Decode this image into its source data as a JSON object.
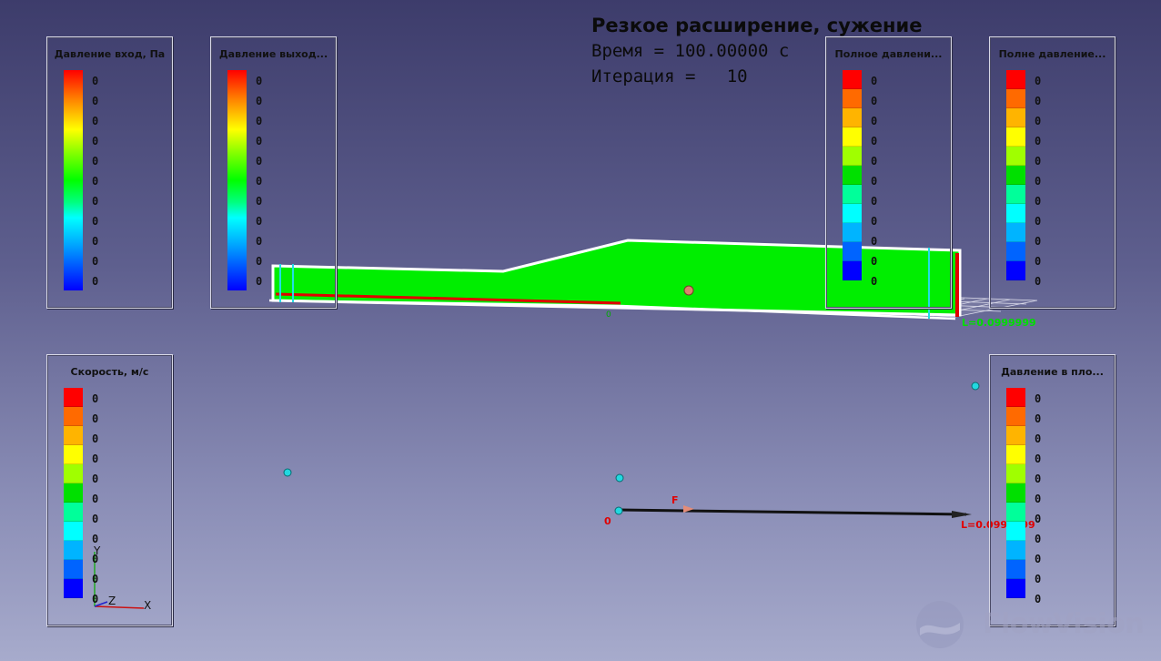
{
  "hud": {
    "title": "Резкое расширение, сужение",
    "time_line": "Время = 100.00000 с",
    "iteration_line": "Итерация =   10"
  },
  "legends": {
    "inlet_pressure": {
      "title": "Давление вход, Па",
      "style": "gradient",
      "values": [
        "0",
        "0",
        "0",
        "0",
        "0",
        "0",
        "0",
        "0",
        "0",
        "0",
        "0"
      ]
    },
    "outlet_pressure": {
      "title": "Давление выход...",
      "style": "gradient",
      "values": [
        "0",
        "0",
        "0",
        "0",
        "0",
        "0",
        "0",
        "0",
        "0",
        "0",
        "0"
      ]
    },
    "total_pressure_1": {
      "title": "Полное давлени...",
      "style": "discrete",
      "values": [
        "0",
        "0",
        "0",
        "0",
        "0",
        "0",
        "0",
        "0",
        "0",
        "0",
        "0"
      ]
    },
    "total_pressure_2": {
      "title": "Полне давление...",
      "style": "discrete",
      "values": [
        "0",
        "0",
        "0",
        "0",
        "0",
        "0",
        "0",
        "0",
        "0",
        "0",
        "0"
      ]
    },
    "velocity": {
      "title": "Скорость, м/с",
      "style": "discrete",
      "values": [
        "0",
        "0",
        "0",
        "0",
        "0",
        "0",
        "0",
        "0",
        "0",
        "0",
        "0"
      ]
    },
    "plane_pressure": {
      "title": "Давление в пло...",
      "style": "discrete",
      "values": [
        "0",
        "0",
        "0",
        "0",
        "0",
        "0",
        "0",
        "0",
        "0",
        "0",
        "0"
      ]
    }
  },
  "discrete_colors": [
    "#ff0000",
    "#ff6a00",
    "#ffb400",
    "#ffff00",
    "#a0ff00",
    "#00e000",
    "#00ff9a",
    "#00ffff",
    "#00b4ff",
    "#0064ff",
    "#0000ff"
  ],
  "scene": {
    "length_label_top": "L=0.0999999",
    "length_label_bottom": "L=0.0999999",
    "origin_label": "0",
    "force_label": "F",
    "small_zero_label": "0",
    "axis_x": "X",
    "axis_y": "Y",
    "axis_z": "Z",
    "fluid_color": "#00ee00",
    "boundary_color": "#e00000",
    "watermark": "FlowVision"
  }
}
